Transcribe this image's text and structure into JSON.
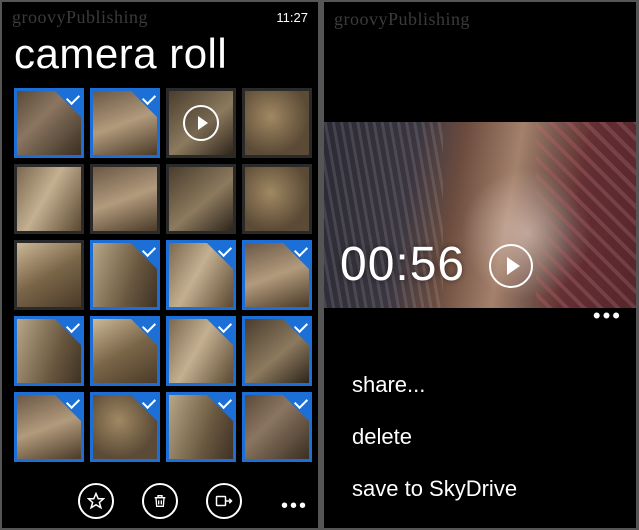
{
  "leftScreen": {
    "watermark": "groovyPublishing",
    "clock": "11:27",
    "title": "camera roll",
    "thumbs": [
      {
        "tex": "a",
        "selected": true,
        "video": false
      },
      {
        "tex": "b",
        "selected": true,
        "video": false
      },
      {
        "tex": "e",
        "selected": false,
        "video": true
      },
      {
        "tex": "c",
        "selected": false,
        "video": false
      },
      {
        "tex": "d",
        "selected": false,
        "video": false
      },
      {
        "tex": "b",
        "selected": false,
        "video": false
      },
      {
        "tex": "e",
        "selected": false,
        "video": false
      },
      {
        "tex": "c",
        "selected": false,
        "video": false
      },
      {
        "tex": "g",
        "selected": false,
        "video": false
      },
      {
        "tex": "f",
        "selected": true,
        "video": false
      },
      {
        "tex": "d",
        "selected": true,
        "video": false
      },
      {
        "tex": "b",
        "selected": true,
        "video": false
      },
      {
        "tex": "f",
        "selected": true,
        "video": false
      },
      {
        "tex": "g",
        "selected": true,
        "video": false
      },
      {
        "tex": "d",
        "selected": true,
        "video": false
      },
      {
        "tex": "e",
        "selected": true,
        "video": false
      },
      {
        "tex": "b",
        "selected": true,
        "video": false
      },
      {
        "tex": "c",
        "selected": true,
        "video": false
      },
      {
        "tex": "f",
        "selected": true,
        "video": false
      },
      {
        "tex": "a",
        "selected": true,
        "video": false
      }
    ],
    "appbar": {
      "favorite_label": "favorite",
      "delete_label": "delete",
      "share_label": "share",
      "more_label": "more"
    }
  },
  "rightScreen": {
    "watermark": "groovyPublishing",
    "video": {
      "duration": "00:56",
      "play_label": "play",
      "more_label": "more"
    },
    "menu": {
      "share": "share...",
      "delete": "delete",
      "save": "save to SkyDrive"
    }
  }
}
